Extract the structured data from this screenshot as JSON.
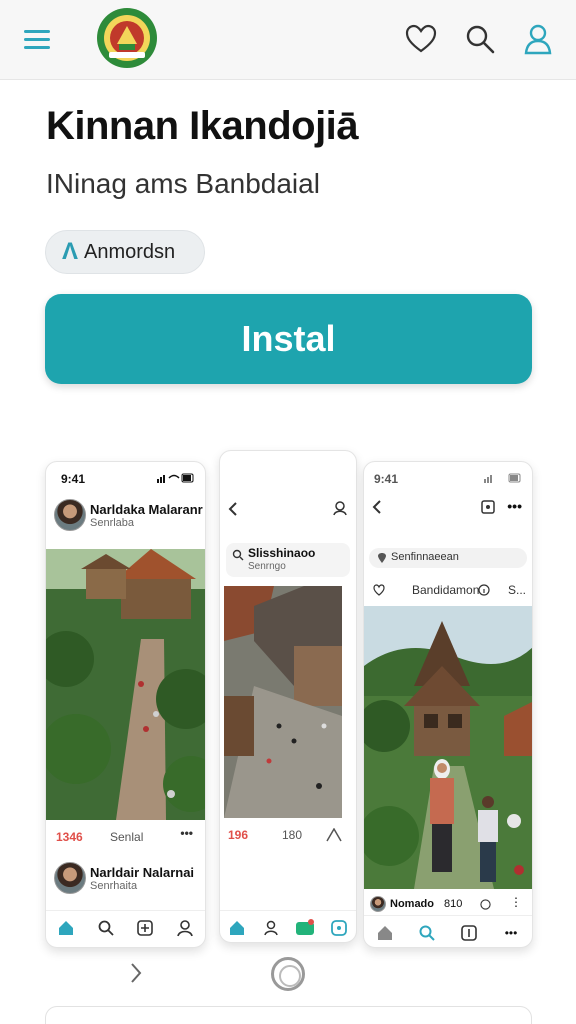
{
  "topbar": {
    "icons": [
      "menu-icon",
      "heart-icon",
      "search-icon",
      "user-icon"
    ]
  },
  "app": {
    "title": "Kinnan Ikandojiā",
    "subtitle": "INinag ams Banbdaial",
    "chip_label": "Anmordsn",
    "install_label": "Instal"
  },
  "screens": {
    "left": {
      "status_time": "9:41",
      "post_name": "Narldaka Malaranr",
      "post_sub": "Senrlaba",
      "likes": "1346",
      "action": "Senlal",
      "post2_name": "Narldair Nalarnai",
      "post2_sub": "Senrhaita"
    },
    "middle": {
      "card_title": "Slisshinaoo",
      "card_sub": "Senrngo",
      "stat1": "196",
      "stat2": "180"
    },
    "right": {
      "status_time": "9:41",
      "search_text": "Senfinnaeean",
      "row_label": "Bandidamon",
      "row_tail": "S...",
      "bottom_name": "Nomado",
      "bottom_num": "810"
    }
  },
  "colors": {
    "accent": "#1ea4ae",
    "icon_teal": "#2ea6bd",
    "badge_red": "#e0504a",
    "badge_green": "#22b37a"
  }
}
